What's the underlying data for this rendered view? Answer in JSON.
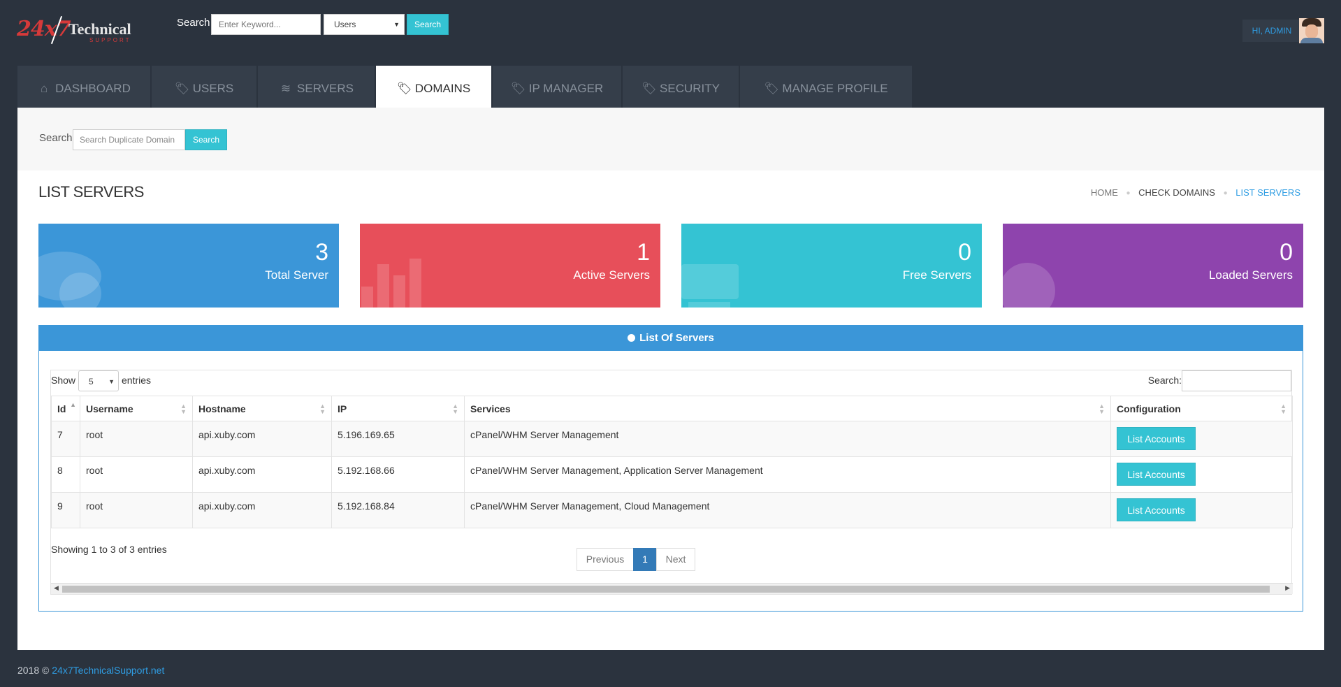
{
  "brand": {
    "logo_number": "24x7",
    "logo_word": "Technical",
    "logo_sub": "SUPPORT"
  },
  "top_search": {
    "label": "Search",
    "placeholder": "Enter Keyword...",
    "select_value": "Users",
    "button": "Search"
  },
  "user": {
    "greeting": "HI, ADMIN"
  },
  "nav": {
    "tabs": [
      {
        "label": "DASHBOARD",
        "icon": "home-icon",
        "active": false
      },
      {
        "label": "USERS",
        "icon": "tag-icon",
        "active": false
      },
      {
        "label": "SERVERS",
        "icon": "layers-icon",
        "active": false
      },
      {
        "label": "DOMAINS",
        "icon": "tag-icon",
        "active": true
      },
      {
        "label": "IP MANAGER",
        "icon": "tag-icon",
        "active": false
      },
      {
        "label": "SECURITY",
        "icon": "tag-icon",
        "active": false
      },
      {
        "label": "MANAGE PROFILE",
        "icon": "tag-icon",
        "active": false
      }
    ]
  },
  "dup_search": {
    "label": "Search",
    "placeholder": "Search Duplicate Domain",
    "button": "Search"
  },
  "page": {
    "title": "LIST SERVERS"
  },
  "breadcrumb": [
    "HOME",
    "CHECK DOMAINS",
    "LIST SERVERS"
  ],
  "stats": [
    {
      "value": "3",
      "label": "Total Server",
      "color": "#3b96d8"
    },
    {
      "value": "1",
      "label": "Active Servers",
      "color": "#e74f5a"
    },
    {
      "value": "0",
      "label": "Free Servers",
      "color": "#34c3d3"
    },
    {
      "value": "0",
      "label": "Loaded Servers",
      "color": "#8e44ad"
    }
  ],
  "list": {
    "title": "List Of Servers",
    "show_label": "Show",
    "show_value": "5",
    "entries_label": "entries",
    "search_label": "Search:",
    "columns": [
      "Id",
      "Username",
      "Hostname",
      "IP",
      "Services",
      "Configuration"
    ],
    "rows": [
      {
        "id": "7",
        "username": "root",
        "hostname": "api.xuby.com",
        "ip": "5.196.169.65",
        "services": "cPanel/WHM Server Management",
        "action": "List Accounts"
      },
      {
        "id": "8",
        "username": "root",
        "hostname": "api.xuby.com",
        "ip": "5.192.168.66",
        "services": "cPanel/WHM Server Management, Application Server Management",
        "action": "List Accounts"
      },
      {
        "id": "9",
        "username": "root",
        "hostname": "api.xuby.com",
        "ip": "5.192.168.84",
        "services": "cPanel/WHM Server Management, Cloud Management",
        "action": "List Accounts"
      }
    ],
    "info": "Showing 1 to 3 of 3 entries",
    "pager": {
      "prev": "Previous",
      "current": "1",
      "next": "Next"
    }
  },
  "footer": {
    "copyright": "2018 ©",
    "link": "24x7TechnicalSupport.net"
  }
}
